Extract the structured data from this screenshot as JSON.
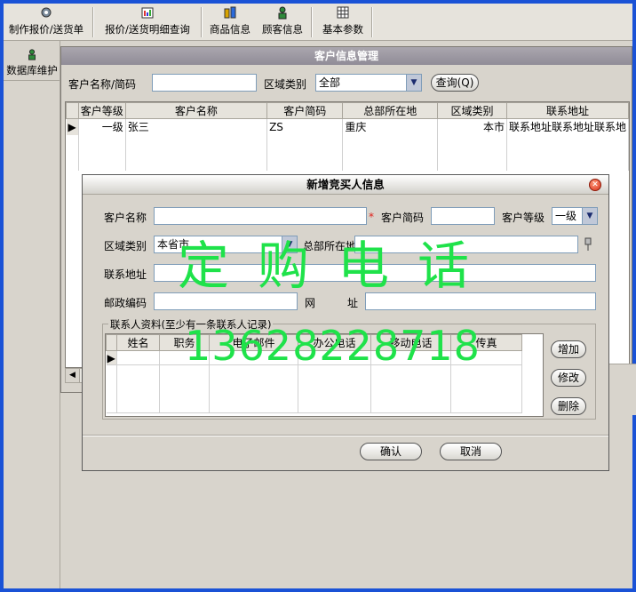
{
  "toolbar": {
    "items": [
      {
        "label": "制作报价/送货单",
        "icon": "gear-icon"
      },
      {
        "label": "报价/送货明细查询",
        "icon": "report-icon"
      },
      {
        "label": "商品信息",
        "icon": "goods-icon"
      },
      {
        "label": "顾客信息",
        "icon": "customer-icon"
      },
      {
        "label": "基本参数",
        "icon": "grid-icon"
      }
    ]
  },
  "left_panel": {
    "item_label": "数据库维护",
    "icon": "user-icon"
  },
  "customer_window": {
    "title": "客户信息管理",
    "search": {
      "name_label": "客户名称/简码",
      "name_value": "",
      "region_label": "区域类别",
      "region_value": "全部",
      "query_button": "查询(Q)"
    },
    "table": {
      "columns": [
        "客户等级",
        "客户名称",
        "客户简码",
        "总部所在地",
        "区域类别",
        "联系地址"
      ],
      "rows": [
        {
          "level": "一级",
          "name": "张三",
          "code": "ZS",
          "hq": "重庆",
          "region": "本市",
          "address": "联系地址联系地址联系地"
        }
      ]
    }
  },
  "dialog": {
    "title": "新增竞买人信息",
    "fields": {
      "customer_name_label": "客户名称",
      "customer_name_value": "",
      "required_mark": "*",
      "short_code_label": "客户简码",
      "short_code_value": "",
      "level_label": "客户等级",
      "level_value": "一级",
      "region_label": "区域类别",
      "region_value": "本省市",
      "hq_label": "总部所在地",
      "hq_value": "",
      "address_label": "联系地址",
      "address_value": "",
      "postcode_label": "邮政编码",
      "postcode_value": "",
      "website_label_1": "网",
      "website_label_2": "址",
      "website_value": ""
    },
    "contacts": {
      "group_label": "联系人资料(至少有一条联系人记录)",
      "columns": [
        "姓名",
        "职务",
        "电子邮件",
        "办公电话",
        "移动电话",
        "传真"
      ],
      "add_button": "增加",
      "edit_button": "修改",
      "delete_button": "删除"
    },
    "ok_button": "确认",
    "cancel_button": "取消"
  },
  "watermark": {
    "line1": "定购电话",
    "line2": "13628228718"
  },
  "colors": {
    "desktop": "#1a52d6",
    "watermark": "#1fe24a",
    "window_title": "#908c97"
  }
}
